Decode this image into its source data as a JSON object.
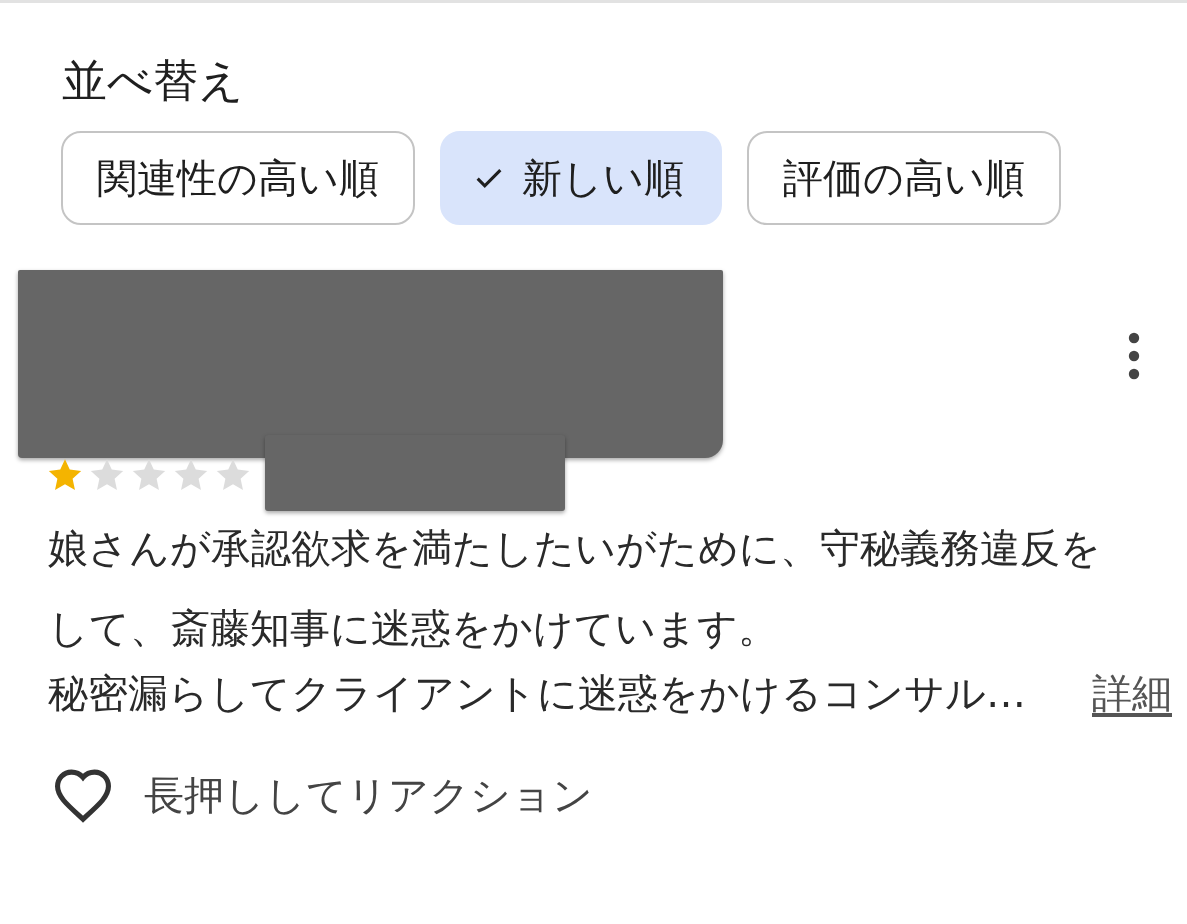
{
  "sort": {
    "title": "並べ替え",
    "chips": [
      {
        "label": "関連性の高い順",
        "selected": false
      },
      {
        "label": "新しい順",
        "selected": true
      },
      {
        "label": "評価の高い順",
        "selected": false
      }
    ]
  },
  "review": {
    "redactions": [
      {
        "kind": "name"
      },
      {
        "kind": "date"
      }
    ],
    "stars": 1,
    "text_lines": [
      "娘さんが承認欲求を満たしたいがために、守秘義務違反を",
      "して、斎藤知事に迷惑をかけています。",
      "秘密漏らしてクライアントに迷惑をかけるコンサル…"
    ],
    "more_link": "詳細",
    "reaction_hint": "長押ししてリアクション"
  }
}
